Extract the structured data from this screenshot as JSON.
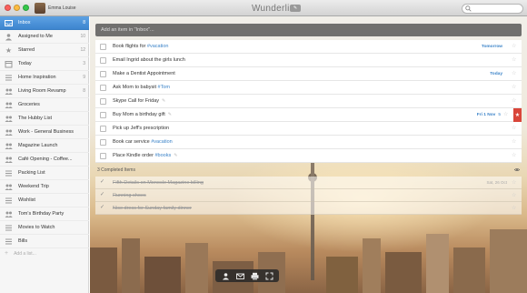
{
  "window": {
    "title": "Wunderlist",
    "user_name": "Emma Louise"
  },
  "sidebar": {
    "items": [
      {
        "label": "Inbox",
        "count": "8",
        "icon": "inbox-icon",
        "active": true
      },
      {
        "label": "Assigned to Me",
        "count": "10",
        "icon": "person-icon"
      },
      {
        "label": "Starred",
        "count": "12",
        "icon": "star-icon"
      },
      {
        "label": "Today",
        "count": "3",
        "icon": "calendar-icon"
      },
      {
        "label": "Home Inspiration",
        "count": "9",
        "icon": "list-icon"
      },
      {
        "label": "Living Room Revamp",
        "count": "8",
        "icon": "shared-list-icon"
      },
      {
        "label": "Groceries",
        "count": "",
        "icon": "shared-list-icon"
      },
      {
        "label": "The Hubby List",
        "count": "",
        "icon": "shared-list-icon"
      },
      {
        "label": "Work - General Business",
        "count": "",
        "icon": "shared-list-icon"
      },
      {
        "label": "Magazine Launch",
        "count": "",
        "icon": "shared-list-icon"
      },
      {
        "label": "Café Opening - Coffee...",
        "count": "",
        "icon": "shared-list-icon"
      },
      {
        "label": "Packing List",
        "count": "",
        "icon": "list-icon"
      },
      {
        "label": "Weekend Trip",
        "count": "",
        "icon": "shared-list-icon"
      },
      {
        "label": "Wishlist",
        "count": "",
        "icon": "list-icon"
      },
      {
        "label": "Tom's Birthday Party",
        "count": "",
        "icon": "shared-list-icon"
      },
      {
        "label": "Movies to Watch",
        "count": "",
        "icon": "list-icon"
      },
      {
        "label": "Bills",
        "count": "",
        "icon": "list-icon"
      }
    ],
    "add_list_label": "Add a list..."
  },
  "main": {
    "add_placeholder": "Add an item in \"Inbox\"...",
    "tasks": [
      {
        "text": "Book flights for ",
        "tag": "#vacation",
        "due": "Tomorrow"
      },
      {
        "text": "Email Ingrid about the girls lunch",
        "tag": "",
        "due": ""
      },
      {
        "text": "Make a Dentist Appointment",
        "tag": "",
        "due": "Today"
      },
      {
        "text": "Ask Mom to babysit ",
        "tag": "#Tom",
        "due": ""
      },
      {
        "text": "Skype Call for Friday",
        "tag": "",
        "due": "",
        "note": true
      },
      {
        "text": "Buy Mom a birthday gift",
        "tag": "",
        "due": "Fri 1 Nov",
        "note": true,
        "flag": true,
        "pct": "5"
      },
      {
        "text": "Pick up Jeff's prescription",
        "tag": "",
        "due": ""
      },
      {
        "text": "Book car service ",
        "tag": "#vacation",
        "due": ""
      },
      {
        "text": "Place Kindle order ",
        "tag": "#books",
        "due": "",
        "note": true
      }
    ],
    "completed_header": "3 Completed Items",
    "completed": [
      {
        "text": "Fifth Details on Monocle Magazine billing",
        "meta": "Sat, 26 Oct"
      },
      {
        "text": "Running shoes",
        "meta": ""
      },
      {
        "text": "Nice dress for Sunday family dinner",
        "meta": ""
      }
    ],
    "toolbar_icons": [
      "share-icon",
      "mail-icon",
      "print-icon",
      "fullscreen-icon"
    ]
  },
  "colors": {
    "accent": "#3d85cf",
    "tag": "#3b83c8",
    "flag": "#d9453a"
  }
}
